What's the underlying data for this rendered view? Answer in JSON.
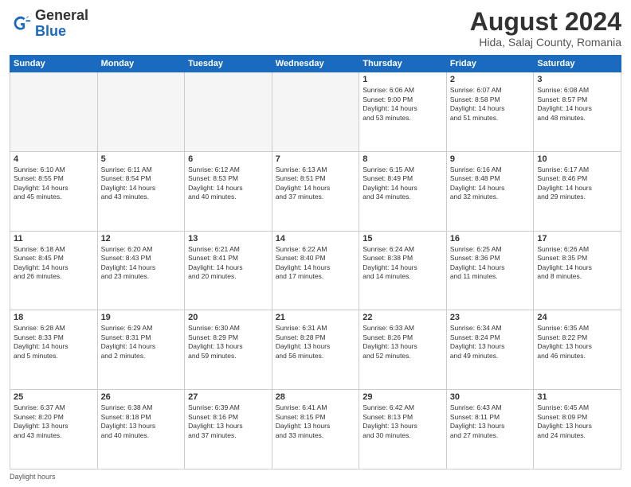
{
  "header": {
    "logo_general": "General",
    "logo_blue": "Blue",
    "month_title": "August 2024",
    "location": "Hida, Salaj County, Romania"
  },
  "days_of_week": [
    "Sunday",
    "Monday",
    "Tuesday",
    "Wednesday",
    "Thursday",
    "Friday",
    "Saturday"
  ],
  "weeks": [
    [
      {
        "day": "",
        "info": ""
      },
      {
        "day": "",
        "info": ""
      },
      {
        "day": "",
        "info": ""
      },
      {
        "day": "",
        "info": ""
      },
      {
        "day": "1",
        "info": "Sunrise: 6:06 AM\nSunset: 9:00 PM\nDaylight: 14 hours\nand 53 minutes."
      },
      {
        "day": "2",
        "info": "Sunrise: 6:07 AM\nSunset: 8:58 PM\nDaylight: 14 hours\nand 51 minutes."
      },
      {
        "day": "3",
        "info": "Sunrise: 6:08 AM\nSunset: 8:57 PM\nDaylight: 14 hours\nand 48 minutes."
      }
    ],
    [
      {
        "day": "4",
        "info": "Sunrise: 6:10 AM\nSunset: 8:55 PM\nDaylight: 14 hours\nand 45 minutes."
      },
      {
        "day": "5",
        "info": "Sunrise: 6:11 AM\nSunset: 8:54 PM\nDaylight: 14 hours\nand 43 minutes."
      },
      {
        "day": "6",
        "info": "Sunrise: 6:12 AM\nSunset: 8:53 PM\nDaylight: 14 hours\nand 40 minutes."
      },
      {
        "day": "7",
        "info": "Sunrise: 6:13 AM\nSunset: 8:51 PM\nDaylight: 14 hours\nand 37 minutes."
      },
      {
        "day": "8",
        "info": "Sunrise: 6:15 AM\nSunset: 8:49 PM\nDaylight: 14 hours\nand 34 minutes."
      },
      {
        "day": "9",
        "info": "Sunrise: 6:16 AM\nSunset: 8:48 PM\nDaylight: 14 hours\nand 32 minutes."
      },
      {
        "day": "10",
        "info": "Sunrise: 6:17 AM\nSunset: 8:46 PM\nDaylight: 14 hours\nand 29 minutes."
      }
    ],
    [
      {
        "day": "11",
        "info": "Sunrise: 6:18 AM\nSunset: 8:45 PM\nDaylight: 14 hours\nand 26 minutes."
      },
      {
        "day": "12",
        "info": "Sunrise: 6:20 AM\nSunset: 8:43 PM\nDaylight: 14 hours\nand 23 minutes."
      },
      {
        "day": "13",
        "info": "Sunrise: 6:21 AM\nSunset: 8:41 PM\nDaylight: 14 hours\nand 20 minutes."
      },
      {
        "day": "14",
        "info": "Sunrise: 6:22 AM\nSunset: 8:40 PM\nDaylight: 14 hours\nand 17 minutes."
      },
      {
        "day": "15",
        "info": "Sunrise: 6:24 AM\nSunset: 8:38 PM\nDaylight: 14 hours\nand 14 minutes."
      },
      {
        "day": "16",
        "info": "Sunrise: 6:25 AM\nSunset: 8:36 PM\nDaylight: 14 hours\nand 11 minutes."
      },
      {
        "day": "17",
        "info": "Sunrise: 6:26 AM\nSunset: 8:35 PM\nDaylight: 14 hours\nand 8 minutes."
      }
    ],
    [
      {
        "day": "18",
        "info": "Sunrise: 6:28 AM\nSunset: 8:33 PM\nDaylight: 14 hours\nand 5 minutes."
      },
      {
        "day": "19",
        "info": "Sunrise: 6:29 AM\nSunset: 8:31 PM\nDaylight: 14 hours\nand 2 minutes."
      },
      {
        "day": "20",
        "info": "Sunrise: 6:30 AM\nSunset: 8:29 PM\nDaylight: 13 hours\nand 59 minutes."
      },
      {
        "day": "21",
        "info": "Sunrise: 6:31 AM\nSunset: 8:28 PM\nDaylight: 13 hours\nand 56 minutes."
      },
      {
        "day": "22",
        "info": "Sunrise: 6:33 AM\nSunset: 8:26 PM\nDaylight: 13 hours\nand 52 minutes."
      },
      {
        "day": "23",
        "info": "Sunrise: 6:34 AM\nSunset: 8:24 PM\nDaylight: 13 hours\nand 49 minutes."
      },
      {
        "day": "24",
        "info": "Sunrise: 6:35 AM\nSunset: 8:22 PM\nDaylight: 13 hours\nand 46 minutes."
      }
    ],
    [
      {
        "day": "25",
        "info": "Sunrise: 6:37 AM\nSunset: 8:20 PM\nDaylight: 13 hours\nand 43 minutes."
      },
      {
        "day": "26",
        "info": "Sunrise: 6:38 AM\nSunset: 8:18 PM\nDaylight: 13 hours\nand 40 minutes."
      },
      {
        "day": "27",
        "info": "Sunrise: 6:39 AM\nSunset: 8:16 PM\nDaylight: 13 hours\nand 37 minutes."
      },
      {
        "day": "28",
        "info": "Sunrise: 6:41 AM\nSunset: 8:15 PM\nDaylight: 13 hours\nand 33 minutes."
      },
      {
        "day": "29",
        "info": "Sunrise: 6:42 AM\nSunset: 8:13 PM\nDaylight: 13 hours\nand 30 minutes."
      },
      {
        "day": "30",
        "info": "Sunrise: 6:43 AM\nSunset: 8:11 PM\nDaylight: 13 hours\nand 27 minutes."
      },
      {
        "day": "31",
        "info": "Sunrise: 6:45 AM\nSunset: 8:09 PM\nDaylight: 13 hours\nand 24 minutes."
      }
    ]
  ],
  "footer": {
    "note": "Daylight hours"
  }
}
